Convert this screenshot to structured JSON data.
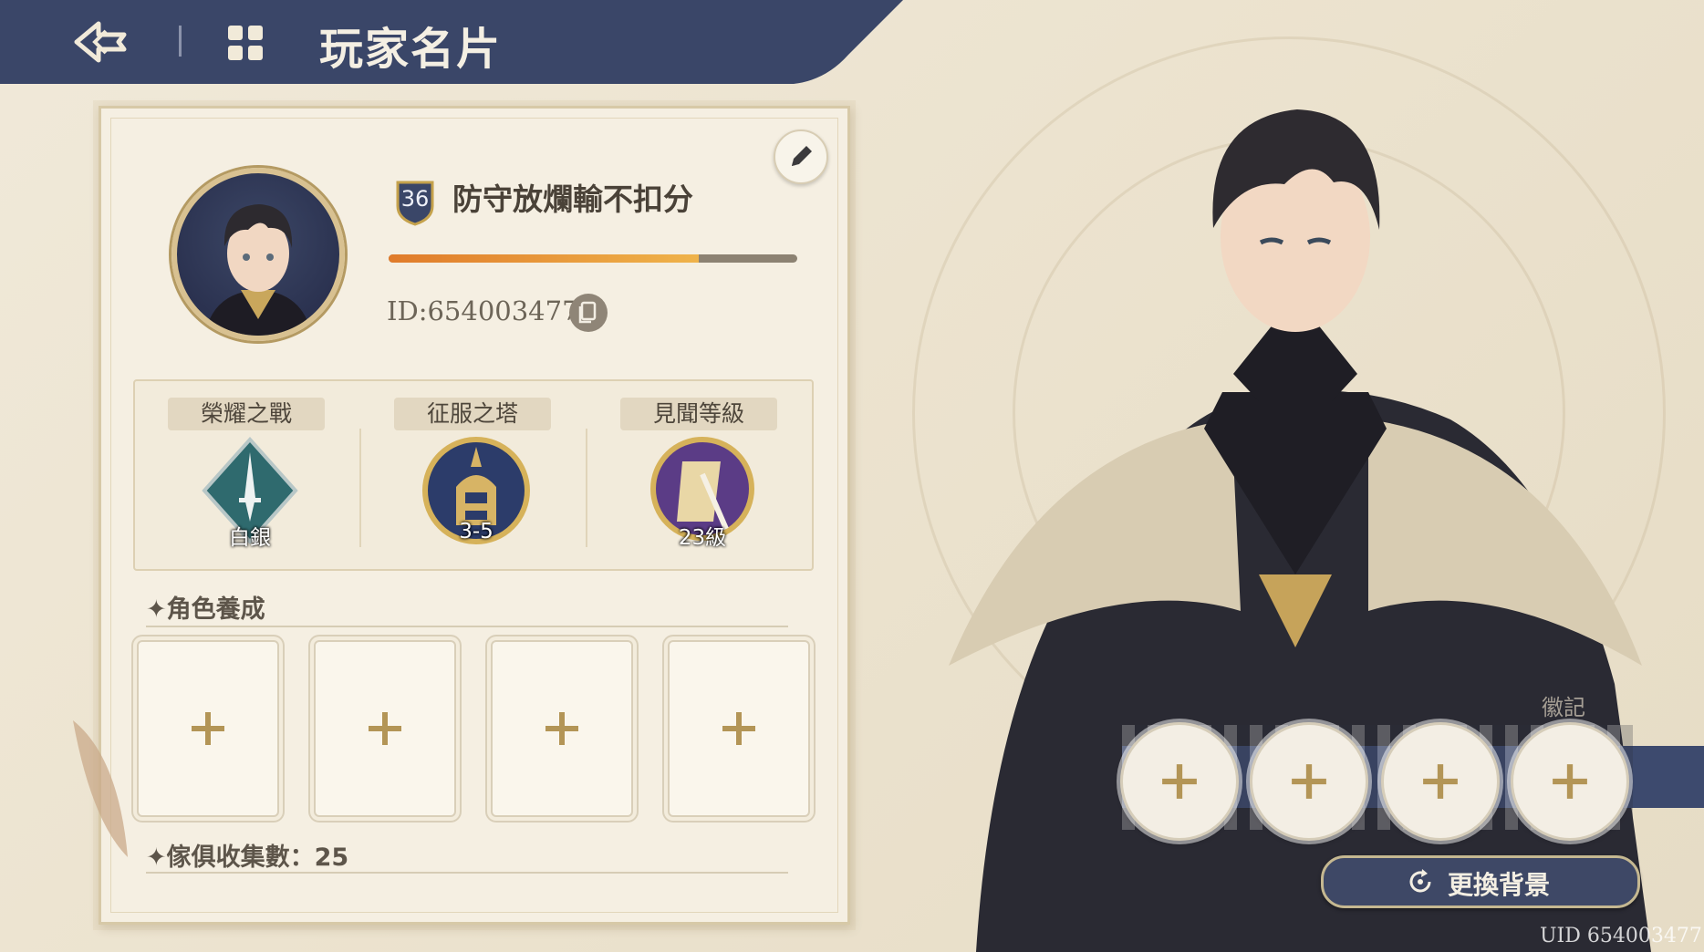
{
  "header": {
    "title": "玩家名片"
  },
  "profile": {
    "level": "36",
    "name": "防守放爛輸不扣分",
    "exp_progress": 0.76,
    "id_text": "ID:654003477"
  },
  "stats": [
    {
      "label": "榮耀之戰",
      "value": "白銀"
    },
    {
      "label": "征服之塔",
      "value": "3-5"
    },
    {
      "label": "見聞等級",
      "value": "23級"
    }
  ],
  "sections": {
    "character_training": "角色養成",
    "furniture": "傢俱收集數：25"
  },
  "badge_label": "徽記",
  "change_background": "更換背景",
  "footer": {
    "uid": "UID 654003477"
  },
  "colors": {
    "header_navy": "#3a4668",
    "exp_orange": "#e89a3a",
    "card_bg": "#f5efe2"
  }
}
